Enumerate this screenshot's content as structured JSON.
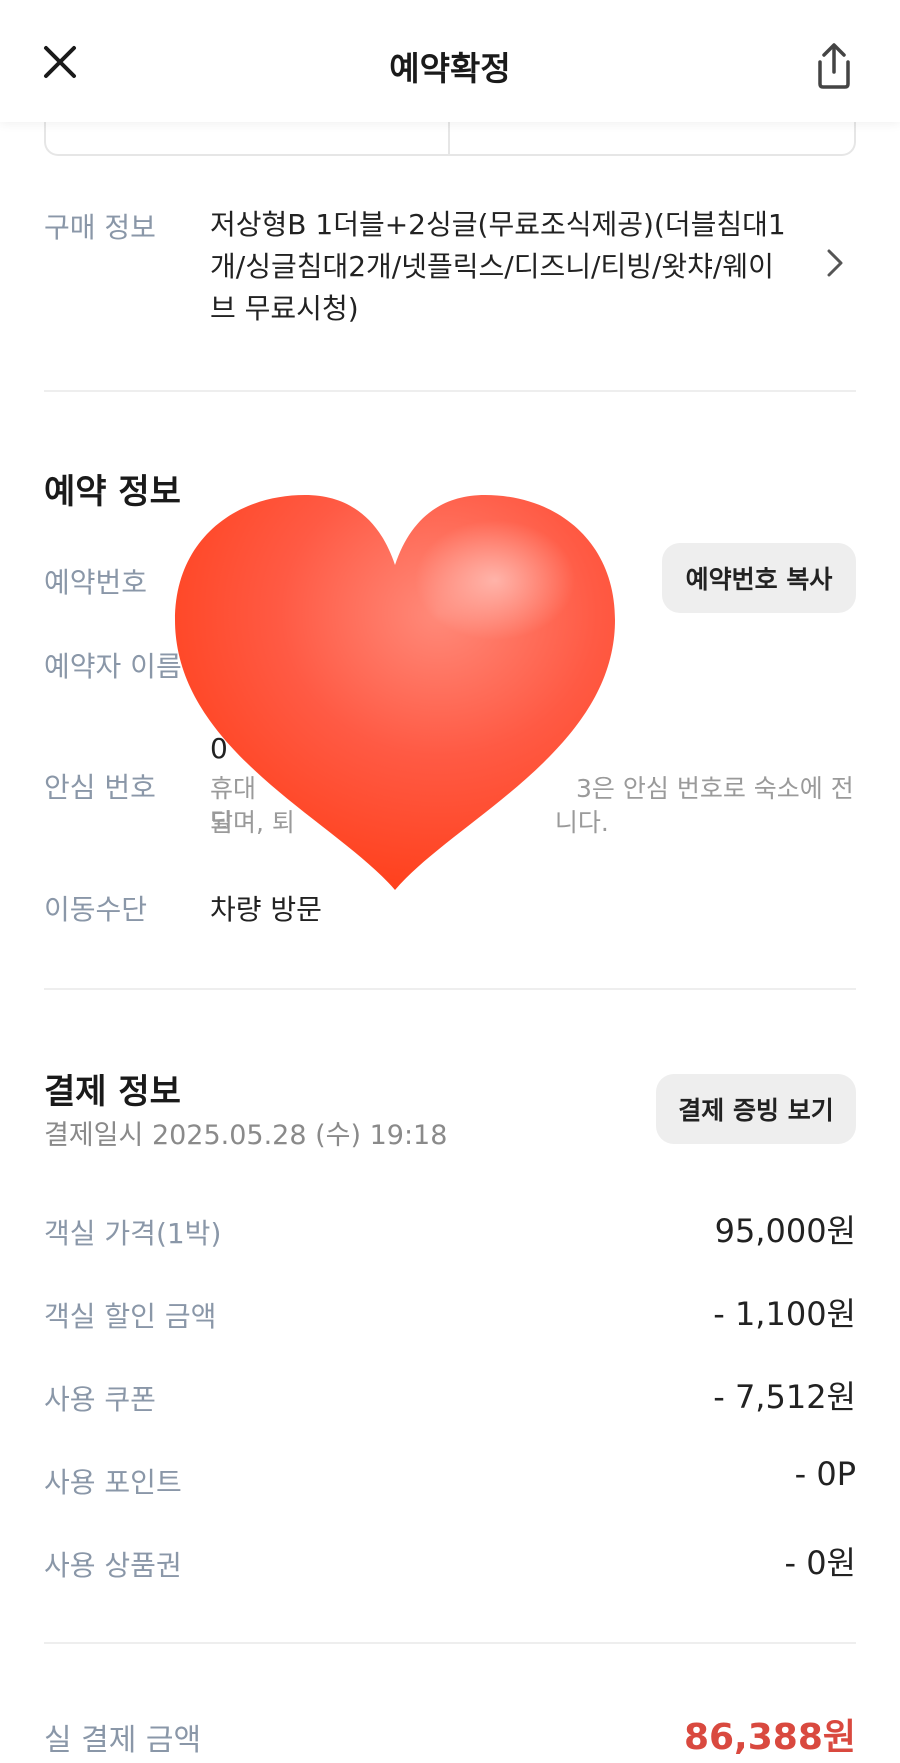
{
  "header": {
    "title": "예약확정",
    "close_icon": "close-icon",
    "share_icon": "share-icon"
  },
  "purchase": {
    "label": "구매 정보",
    "lines": [
      "저상형B 1더블+2싱글(무료조식제공)(더블침대1",
      "개/싱글침대2개/넷플릭스/디즈니/티빙/왓챠/웨이",
      "브 무료시청)"
    ]
  },
  "reservation": {
    "title": "예약 정보",
    "number_label": "예약번호",
    "copy_button": "예약번호 복사",
    "name_label": "예약자 이름",
    "safe_label": "안심 번호",
    "safe_value_partial": "0",
    "safe_note_line1_left": "휴대",
    "safe_note_line1_right": "3은 안심 번호로 숙소에 전달",
    "safe_note_line2_left": "되며, 퇴",
    "safe_note_line2_right": "니다.",
    "transport_label": "이동수단",
    "transport_value": "차량 방문"
  },
  "payment": {
    "title": "결제 정보",
    "date": "결제일시 2025.05.28 (수) 19:18",
    "receipt_button": "결제 증빙 보기",
    "rows": [
      {
        "label": "객실 가격(1박)",
        "value": "95,000원"
      },
      {
        "label": "객실 할인 금액",
        "value": "- 1,100원"
      },
      {
        "label": "사용 쿠폰",
        "value": "- 7,512원"
      },
      {
        "label": "사용 포인트",
        "value": "- 0P"
      },
      {
        "label": "사용 상품권",
        "value": "- 0원"
      }
    ],
    "final_label": "실 결제 금액",
    "final_value": "86,388원"
  },
  "colors": {
    "label": "#8a97a8",
    "final_amount": "#d9493f",
    "button_bg": "#eeeeee",
    "heart": "#ff4b2e"
  },
  "overlay": {
    "icon": "heart-emoji"
  }
}
